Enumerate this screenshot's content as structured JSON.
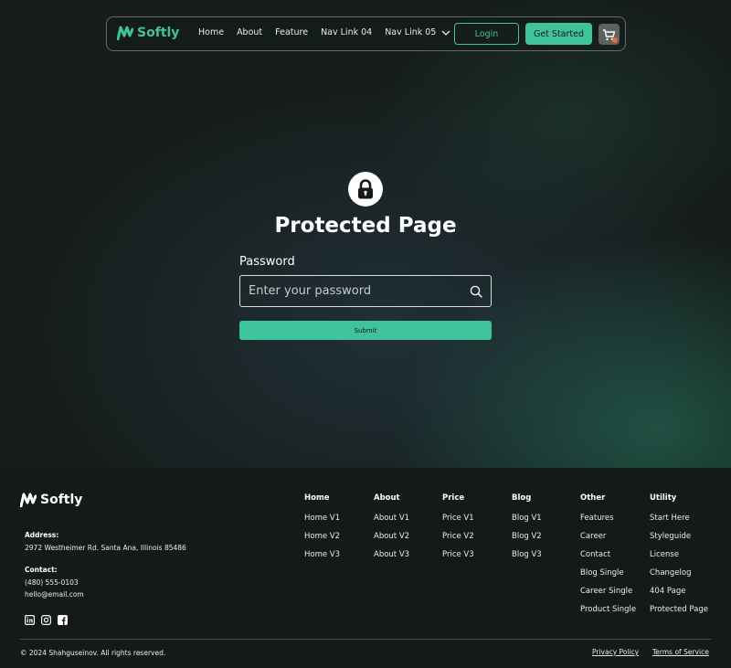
{
  "brand": {
    "name": "Softly",
    "accent_color": "#3ec39a",
    "logo_icon": "softly-logo-icon"
  },
  "navbar": {
    "links": [
      {
        "label": "Home"
      },
      {
        "label": "About"
      },
      {
        "label": "Feature"
      },
      {
        "label": "Nav Link 04"
      },
      {
        "label": "Nav Link 05",
        "has_dropdown": true,
        "icon": "chevron-down-icon"
      }
    ],
    "login_label": "Login",
    "get_started_label": "Get Started",
    "cart_icon": "cart-icon"
  },
  "main": {
    "icon": "lock-icon",
    "title": "Protected Page",
    "password_label": "Password",
    "password_placeholder": "Enter your password",
    "password_value": "",
    "field_icon": "search-icon",
    "submit_label": "Submit"
  },
  "footer": {
    "address_label": "Address:",
    "address": "2972 Westheimer Rd. Santa Ana, Illinois 85486",
    "contact_label": "Contact:",
    "phone": "(480) 555-0103",
    "email": "hello@email.com",
    "social_icons": [
      "linkedin-icon",
      "instagram-icon",
      "facebook-icon"
    ],
    "columns": [
      {
        "heading": "Home",
        "links": [
          "Home V1",
          "Home V2",
          "Home V3"
        ]
      },
      {
        "heading": "About",
        "links": [
          "About V1",
          "About V2",
          "About V3"
        ]
      },
      {
        "heading": "Price",
        "links": [
          "Price V1",
          "Price V2",
          "Price V3"
        ]
      },
      {
        "heading": "Blog",
        "links": [
          "Blog V1",
          "Blog V2",
          "Blog V3"
        ]
      },
      {
        "heading": "Other",
        "links": [
          "Features",
          "Career",
          "Contact",
          "Blog Single",
          "Career Single",
          "Product Single"
        ]
      },
      {
        "heading": "Utility",
        "links": [
          "Start Here",
          "Styleguide",
          "License",
          "Changelog",
          "404 Page",
          "Protected Page"
        ]
      }
    ],
    "copyright": "© 2024 Shahguseinov. All rights reserved.",
    "privacy_label": "Privacy Policy",
    "terms_label": "Terms of Service"
  }
}
